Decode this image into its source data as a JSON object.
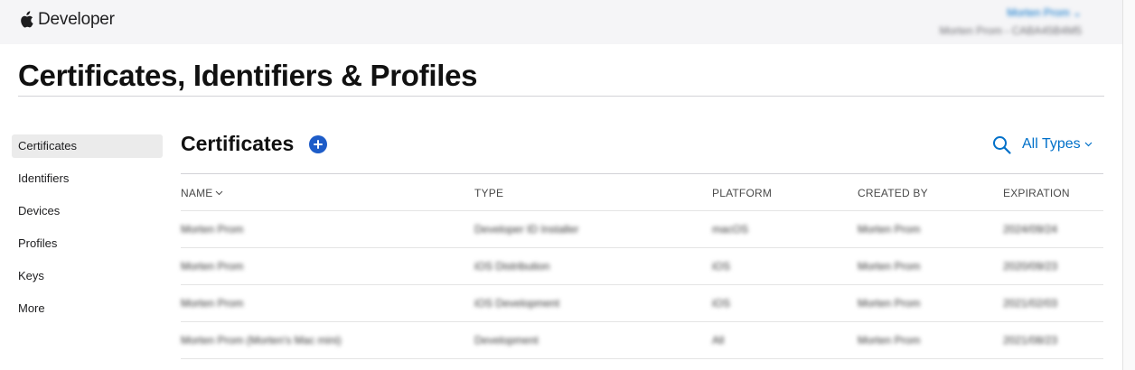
{
  "header": {
    "brand": "Developer",
    "account_name": "Morten Prom",
    "team_label": "Morten Prom - CABA45B4M5"
  },
  "page_title": "Certificates, Identifiers & Profiles",
  "sidebar": {
    "items": [
      {
        "label": "Certificates",
        "active": true
      },
      {
        "label": "Identifiers"
      },
      {
        "label": "Devices"
      },
      {
        "label": "Profiles"
      },
      {
        "label": "Keys"
      },
      {
        "label": "More"
      }
    ]
  },
  "main": {
    "section_title": "Certificates",
    "filter_label": "All Types",
    "columns": {
      "name": "NAME",
      "type": "TYPE",
      "platform": "PLATFORM",
      "created_by": "CREATED BY",
      "expiration": "EXPIRATION"
    },
    "rows": [
      {
        "name": "Morten Prom",
        "type": "Developer ID Installer",
        "platform": "macOS",
        "created_by": "Morten Prom",
        "expiration": "2024/09/24"
      },
      {
        "name": "Morten Prom",
        "type": "iOS Distribution",
        "platform": "iOS",
        "created_by": "Morten Prom",
        "expiration": "2020/09/23"
      },
      {
        "name": "Morten Prom",
        "type": "iOS Development",
        "platform": "iOS",
        "created_by": "Morten Prom",
        "expiration": "2021/02/03"
      },
      {
        "name": "Morten Prom (Morten's Mac mini)",
        "type": "Development",
        "platform": "All",
        "created_by": "Morten Prom",
        "expiration": "2021/08/23"
      }
    ]
  },
  "colors": {
    "accent": "#0070c9",
    "add_button": "#1d5cc8",
    "topbar_bg": "#f5f5f7",
    "active_item_bg": "#ebebeb"
  },
  "icons": {
    "brand": "apple-logo-icon",
    "add": "plus-circle-icon",
    "search": "search-icon",
    "chevron": "chevron-down-icon"
  }
}
